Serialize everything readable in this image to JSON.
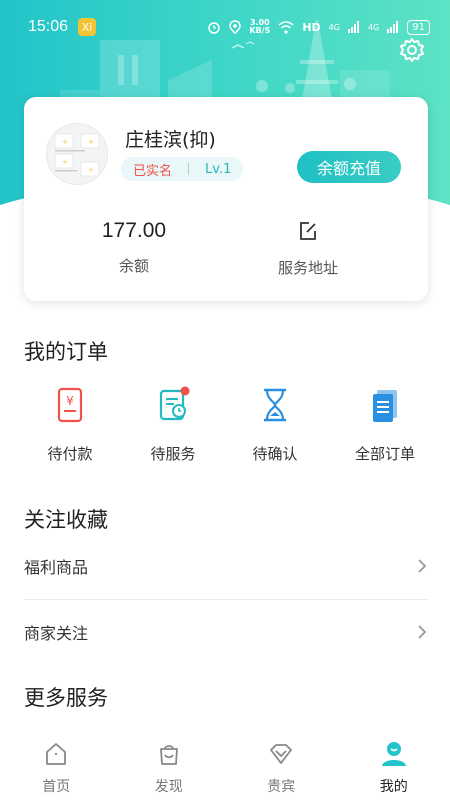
{
  "status_bar": {
    "time": "15:06",
    "app_badge": "Xi",
    "net_speed_value": "3.00",
    "net_speed_unit": "KB/S",
    "hd_label": "HD",
    "signal_1": "4G",
    "signal_2": "4G",
    "battery": "91"
  },
  "profile": {
    "name": "庄桂滨(抑)",
    "verified_tag": "已实名",
    "level_tag": "Lv.1",
    "recharge_button": "余额充值",
    "balance_value": "177.00",
    "balance_label": "余额",
    "address_label": "服务地址"
  },
  "orders": {
    "title": "我的订单",
    "items": [
      {
        "label": "待付款",
        "icon": "payment-pending-icon"
      },
      {
        "label": "待服务",
        "icon": "service-pending-icon"
      },
      {
        "label": "待确认",
        "icon": "confirm-pending-icon"
      },
      {
        "label": "全部订单",
        "icon": "all-orders-icon"
      }
    ]
  },
  "favorites": {
    "title": "关注收藏",
    "items": [
      {
        "label": "福利商品"
      },
      {
        "label": "商家关注"
      }
    ]
  },
  "more_services": {
    "title": "更多服务"
  },
  "bottom_nav": {
    "items": [
      {
        "label": "首页",
        "active": false
      },
      {
        "label": "发现",
        "active": false
      },
      {
        "label": "贵宾",
        "active": false
      },
      {
        "label": "我的",
        "active": true
      }
    ]
  },
  "colors": {
    "accent": "#22c4c9",
    "verified_red": "#f0524a",
    "order_icon_red": "#f0524a",
    "order_icon_teal": "#22b9c0",
    "order_icon_blue": "#2a8fe0"
  }
}
